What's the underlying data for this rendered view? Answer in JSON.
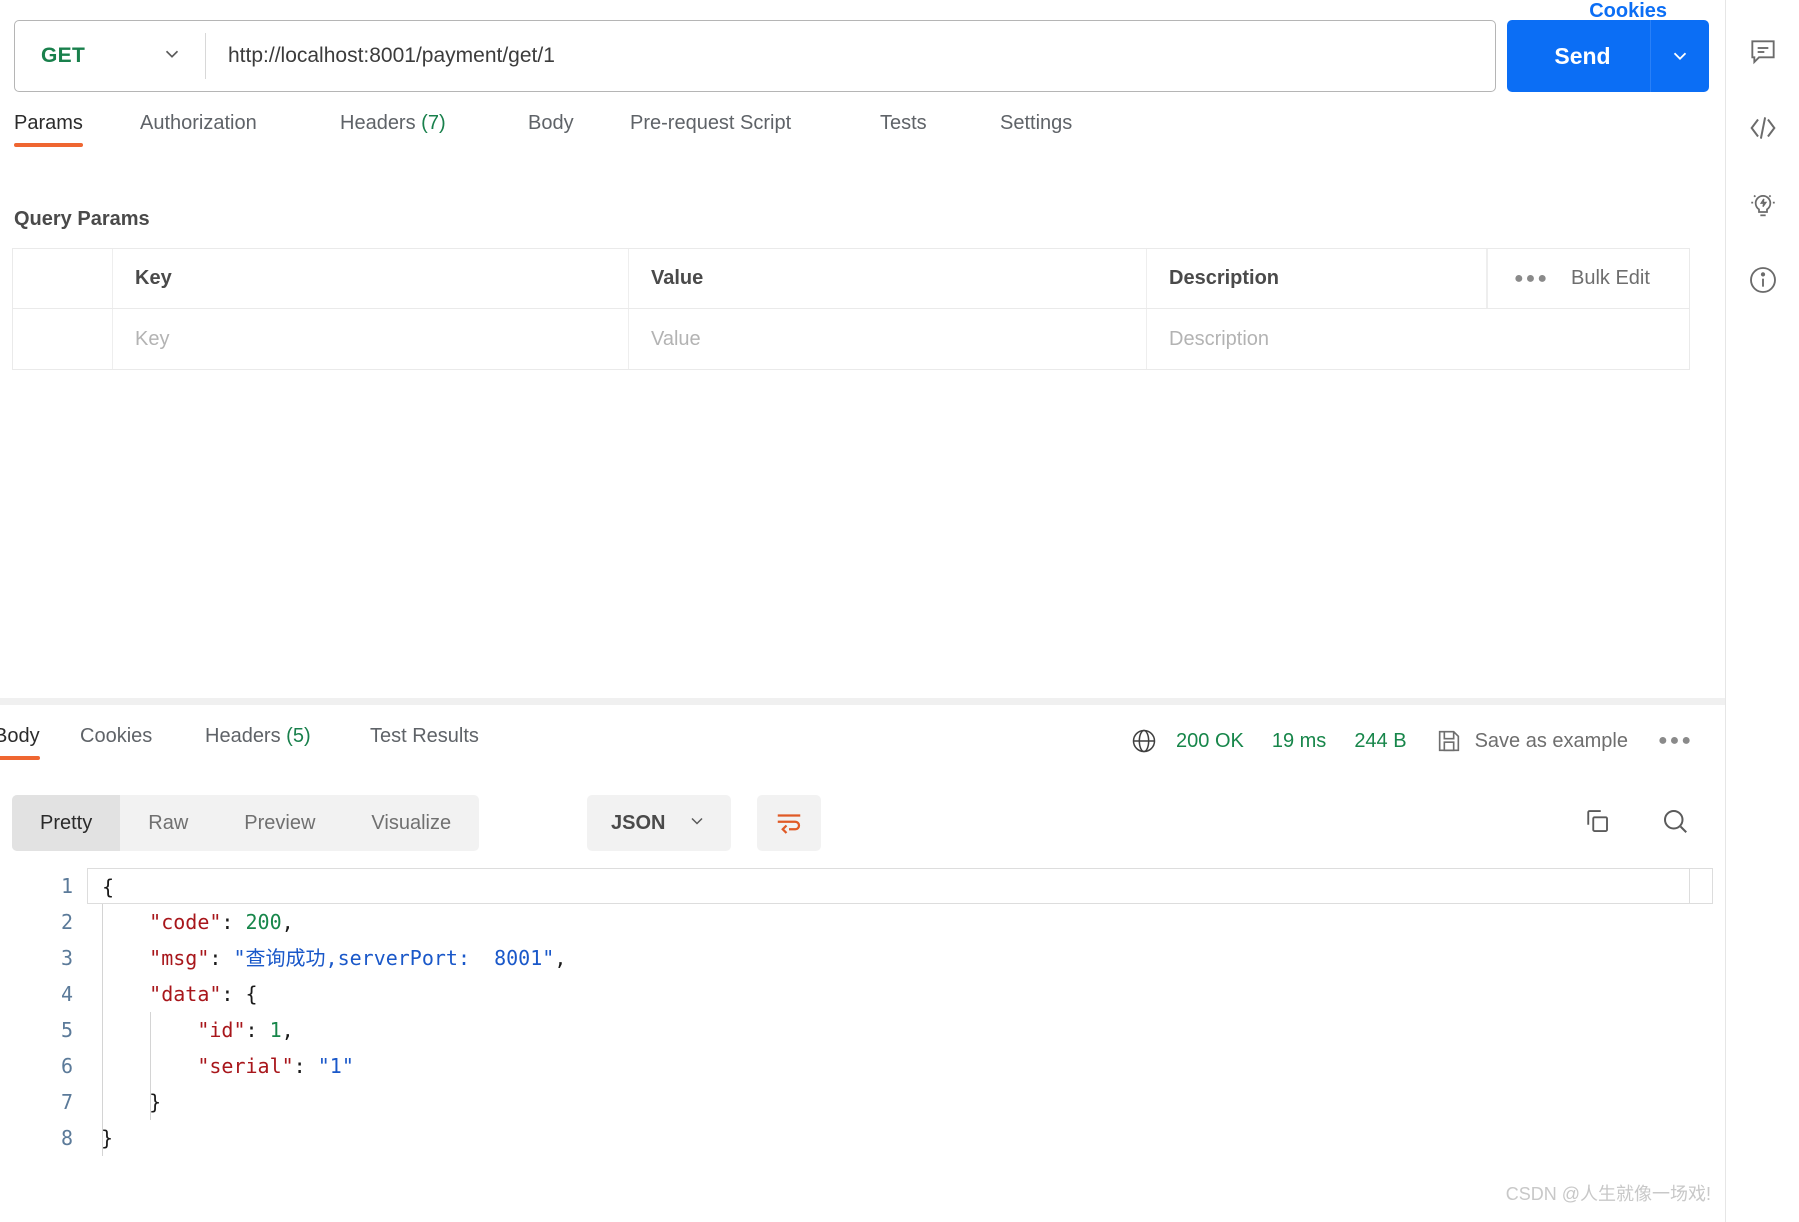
{
  "request": {
    "method": "GET",
    "url": "http://localhost:8001/payment/get/1",
    "send_label": "Send",
    "tabs": [
      {
        "label": "Params",
        "count": ""
      },
      {
        "label": "Authorization",
        "count": ""
      },
      {
        "label": "Headers",
        "count": "(7)"
      },
      {
        "label": "Body",
        "count": ""
      },
      {
        "label": "Pre-request Script",
        "count": ""
      },
      {
        "label": "Tests",
        "count": ""
      },
      {
        "label": "Settings",
        "count": ""
      }
    ],
    "cookies_link": "Cookies",
    "section_title": "Query Params",
    "table": {
      "headers": [
        "Key",
        "Value",
        "Description"
      ],
      "bulk_edit_label": "Bulk Edit",
      "rows": [
        {
          "key": "Key",
          "value": "Value",
          "description": "Description"
        }
      ]
    }
  },
  "response": {
    "tabs": [
      {
        "label": "Body",
        "count": ""
      },
      {
        "label": "Cookies",
        "count": ""
      },
      {
        "label": "Headers",
        "count": "(5)"
      },
      {
        "label": "Test Results",
        "count": ""
      }
    ],
    "status": "200 OK",
    "time": "19 ms",
    "size": "244 B",
    "save_as_example": "Save as example",
    "view_modes": [
      "Pretty",
      "Raw",
      "Preview",
      "Visualize"
    ],
    "format": "JSON",
    "gutter": [
      "1",
      "2",
      "3",
      "4",
      "5",
      "6",
      "7",
      "8"
    ],
    "body_lines": [
      {
        "indent": 0,
        "tokens": [
          {
            "t": "pn",
            "v": "{"
          }
        ]
      },
      {
        "indent": 1,
        "tokens": [
          {
            "t": "k",
            "v": "\"code\""
          },
          {
            "t": "pn",
            "v": ": "
          },
          {
            "t": "num",
            "v": "200"
          },
          {
            "t": "pn",
            "v": ","
          }
        ]
      },
      {
        "indent": 1,
        "tokens": [
          {
            "t": "k",
            "v": "\"msg\""
          },
          {
            "t": "pn",
            "v": ": "
          },
          {
            "t": "str",
            "v": "\"查询成功,serverPort:  8001\""
          },
          {
            "t": "pn",
            "v": ","
          }
        ]
      },
      {
        "indent": 1,
        "tokens": [
          {
            "t": "k",
            "v": "\"data\""
          },
          {
            "t": "pn",
            "v": ": "
          },
          {
            "t": "pn",
            "v": "{"
          }
        ]
      },
      {
        "indent": 2,
        "tokens": [
          {
            "t": "k",
            "v": "\"id\""
          },
          {
            "t": "pn",
            "v": ": "
          },
          {
            "t": "num",
            "v": "1"
          },
          {
            "t": "pn",
            "v": ","
          }
        ]
      },
      {
        "indent": 2,
        "tokens": [
          {
            "t": "k",
            "v": "\"serial\""
          },
          {
            "t": "pn",
            "v": ": "
          },
          {
            "t": "str",
            "v": "\"1\""
          }
        ]
      },
      {
        "indent": 1,
        "tokens": [
          {
            "t": "pn",
            "v": "}"
          }
        ]
      },
      {
        "indent": 0,
        "tokens": [
          {
            "t": "pn",
            "v": "}"
          }
        ]
      }
    ]
  },
  "rail": {
    "icons": [
      "comment-icon",
      "code-icon",
      "lightning-bulb-icon",
      "info-icon"
    ]
  },
  "watermark": "CSDN @人生就像一场戏!",
  "colors": {
    "accent_blue": "#0b6ef5",
    "method_green": "#19804c",
    "status_green": "#17864a",
    "tab_underline": "#ef6631",
    "json_key": "#a8161b",
    "json_string": "#1a58c9",
    "json_number": "#17864a"
  }
}
